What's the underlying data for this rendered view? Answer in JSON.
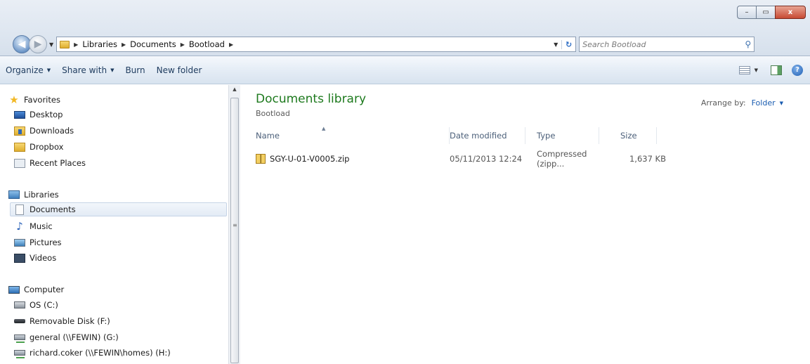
{
  "window": {
    "controls": {
      "minimize": "–",
      "maximize": "▭",
      "close": "x"
    }
  },
  "address_bar": {
    "breadcrumbs": [
      "Libraries",
      "Documents",
      "Bootload"
    ],
    "search_placeholder": "Search Bootload"
  },
  "toolbar": {
    "organize_label": "Organize",
    "share_label": "Share with",
    "burn_label": "Burn",
    "new_folder_label": "New folder"
  },
  "nav": {
    "favorites_label": "Favorites",
    "favorites": [
      "Desktop",
      "Downloads",
      "Dropbox",
      "Recent Places"
    ],
    "libraries_label": "Libraries",
    "libraries": [
      "Documents",
      "Music",
      "Pictures",
      "Videos"
    ],
    "selected": "Documents",
    "computer_label": "Computer",
    "drives": [
      "OS (C:)",
      "Removable Disk (F:)",
      "general (\\\\FEWIN) (G:)",
      "richard.coker (\\\\FEWIN\\homes) (H:)"
    ]
  },
  "content": {
    "library_title": "Documents library",
    "library_subtitle": "Bootload",
    "arrange_label": "Arrange by:",
    "arrange_value": "Folder",
    "columns": {
      "name": "Name",
      "date": "Date modified",
      "type": "Type",
      "size": "Size"
    },
    "files": [
      {
        "name": "SGY-U-01-V0005.zip",
        "date": "05/11/2013 12:24",
        "type": "Compressed (zipp...",
        "size": "1,637 KB"
      }
    ]
  },
  "colors": {
    "library_title": "#1e7a1e",
    "link_blue": "#1a5cb0",
    "toolbar_text": "#1e3b5e"
  }
}
